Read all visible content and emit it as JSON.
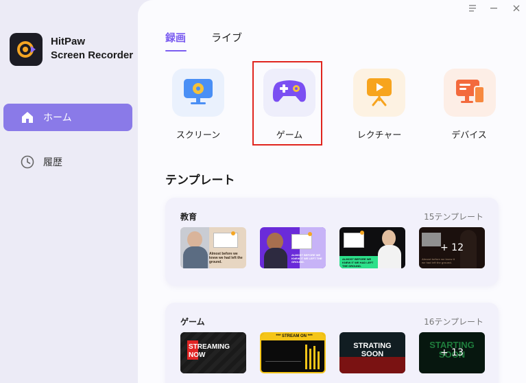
{
  "app": {
    "name_line1": "HitPaw",
    "name_line2": "Screen Recorder"
  },
  "sidebar": {
    "items": [
      {
        "label": "ホーム",
        "icon": "home-icon",
        "active": true
      },
      {
        "label": "履歴",
        "icon": "clock-icon",
        "active": false
      }
    ]
  },
  "window_controls": [
    "menu-icon",
    "minimize-icon",
    "close-icon"
  ],
  "tabs": [
    {
      "label": "録画",
      "active": true
    },
    {
      "label": "ライブ",
      "active": false
    }
  ],
  "modes": [
    {
      "label": "スクリーン",
      "icon": "monitor-icon"
    },
    {
      "label": "ゲーム",
      "icon": "gamepad-icon",
      "selected": true
    },
    {
      "label": "レクチャー",
      "icon": "lecture-board-icon"
    },
    {
      "label": "デバイス",
      "icon": "devices-icon"
    }
  ],
  "templates": {
    "title": "テンプレート",
    "categories": [
      {
        "name": "教育",
        "count": "15テンプレート",
        "thumb_texts": [
          "Almost before we knew we had left the ground.",
          "ALMOST BEFORE WE KNEW IT WE LEFT THE GROUND.",
          "ALMOST BEFORE WE KNEW IT WE HAD LEFT THE GROUND.",
          "Almost before we knew it we had left the ground."
        ],
        "more": "+ 12"
      },
      {
        "name": "ゲーム",
        "count": "16テンプレート",
        "thumb_texts": [
          "STREAMING NOW",
          "*** STREAM ON ***",
          "STRATING SOON",
          "STARTING SOON"
        ],
        "more": "+ 13"
      }
    ]
  },
  "colors": {
    "accent": "#7a5cf0",
    "sidebar_active": "#8a7ae8",
    "selection_border": "#e0241d"
  }
}
